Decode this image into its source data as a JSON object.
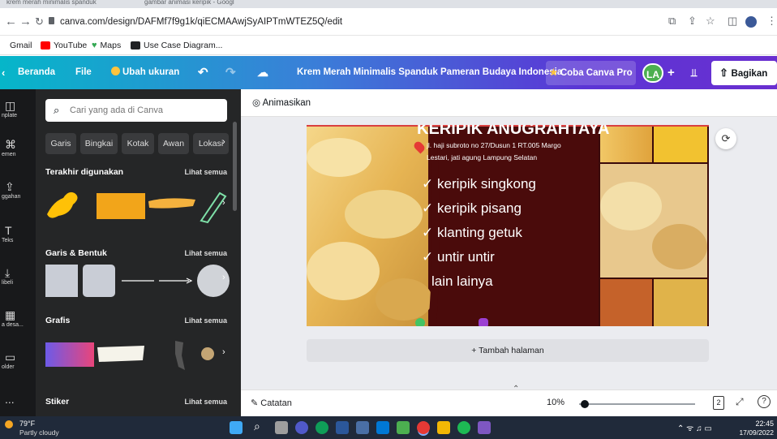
{
  "browser": {
    "tabs": [
      "krem merah minimalis spanduk",
      "gambar animasi keripik - Googl"
    ],
    "url": "canva.com/design/DAFMf7f9g1k/qiECMAAwjSyAIPTmWTEZ5Q/edit",
    "bookmarks": [
      {
        "label": "Gmail",
        "color": "#ea4335"
      },
      {
        "label": "YouTube",
        "color": "#ff0000"
      },
      {
        "label": "Maps",
        "color": "#34a853"
      },
      {
        "label": "Use Case Diagram...",
        "color": "#202124"
      }
    ]
  },
  "header": {
    "home": "Beranda",
    "file": "File",
    "resize": "Ubah ukuran",
    "title": "Krem Merah Minimalis Spanduk Pameran Budaya Indonesia",
    "pro": "Coba Canva Pro",
    "avatar": "LA",
    "share": "Bagikan",
    "colors": {
      "accent": "#7d2ae8",
      "pro_star": "#ffc43d"
    }
  },
  "rail": {
    "items": [
      {
        "label": "nplate",
        "icon": "template-icon"
      },
      {
        "label": "emen",
        "icon": "elements-icon"
      },
      {
        "label": "ggahan",
        "icon": "upload-icon"
      },
      {
        "label": "Teks",
        "icon": "text-icon"
      },
      {
        "label": "libeli",
        "icon": "purchased-icon"
      },
      {
        "label": "a desa...",
        "icon": "apps-icon"
      },
      {
        "label": "older",
        "icon": "folder-icon"
      },
      {
        "label": "...",
        "icon": "more-icon"
      }
    ]
  },
  "panel": {
    "search_placeholder": "Cari yang ada di Canva",
    "chips": [
      "Garis",
      "Bingkai",
      "Kotak",
      "Awan",
      "Lokasi"
    ],
    "see_all": "Lihat semua",
    "sections": {
      "recent": "Terakhir digunakan",
      "lines": "Garis & Bentuk",
      "graphics": "Grafis",
      "stickers": "Stiker"
    }
  },
  "workspace": {
    "animate": "Animasikan",
    "add_page": "+ Tambah halaman",
    "notes": "Catatan",
    "zoom": "10%",
    "zoom_fraction": 0.05,
    "page_count": "2",
    "design": {
      "heading": "KERIPIK ANUGRAHTAYA",
      "address": "jl. haji subroto no 27/Dusun 1 RT.005 Margo Lestari, jati agung Lampung Selatan",
      "items": [
        "keripik singkong",
        "keripik pisang",
        "klanting getuk",
        "untir untir",
        "lain lainya"
      ],
      "check": "✓"
    }
  },
  "taskbar": {
    "temp": "79°F",
    "weather": "Partly cloudy",
    "time": "22:45",
    "date": "17/09/2022"
  }
}
